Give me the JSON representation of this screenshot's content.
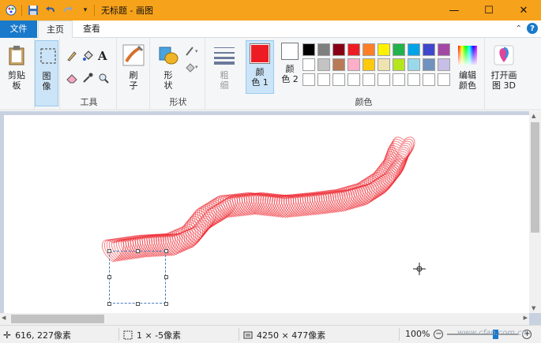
{
  "window": {
    "title": "无标题 - 画图",
    "controls": {
      "minimize": "—",
      "maximize": "☐",
      "close": "✕"
    }
  },
  "tabs": {
    "file": "文件",
    "home": "主页",
    "view": "查看"
  },
  "ribbon": {
    "clipboard": {
      "label": "剪贴\n板"
    },
    "image": {
      "label": "图\n像"
    },
    "tools": {
      "group_label": "工具"
    },
    "brushes": {
      "label": "刷\n子"
    },
    "shapes": {
      "label": "形\n状",
      "group_label": "形状"
    },
    "size": {
      "label": "粗\n细"
    },
    "color1": {
      "label": "颜\n色 1",
      "color": "#ed1c24"
    },
    "color2": {
      "label": "颜\n色 2",
      "color": "#ffffff"
    },
    "colors_group_label": "颜色",
    "edit_colors": {
      "label": "编辑\n颜色"
    },
    "paint3d": {
      "label": "打开画\n图 3D"
    },
    "palette": [
      "#000000",
      "#7f7f7f",
      "#880015",
      "#ed1c24",
      "#ff7f27",
      "#fff200",
      "#22b14c",
      "#00a2e8",
      "#3f48cc",
      "#a349a4",
      "#ffffff",
      "#c3c3c3",
      "#b97a57",
      "#ffaec9",
      "#ffc90e",
      "#efe4b0",
      "#b5e61d",
      "#99d9ea",
      "#7092be",
      "#c8bfe7",
      "#ffffff",
      "#ffffff",
      "#ffffff",
      "#ffffff",
      "#ffffff",
      "#ffffff",
      "#ffffff",
      "#ffffff",
      "#ffffff",
      "#ffffff"
    ]
  },
  "status": {
    "cursor_pos": "616, 227像素",
    "selection_size": "1 × -5像素",
    "image_size": "4250 × 477像素",
    "zoom": "100%"
  },
  "watermark": "www.cfan.com.cn",
  "colors": {
    "accent": "#1979ca",
    "titlebar": "#f7a21b",
    "stroke": "#ed1c24"
  }
}
